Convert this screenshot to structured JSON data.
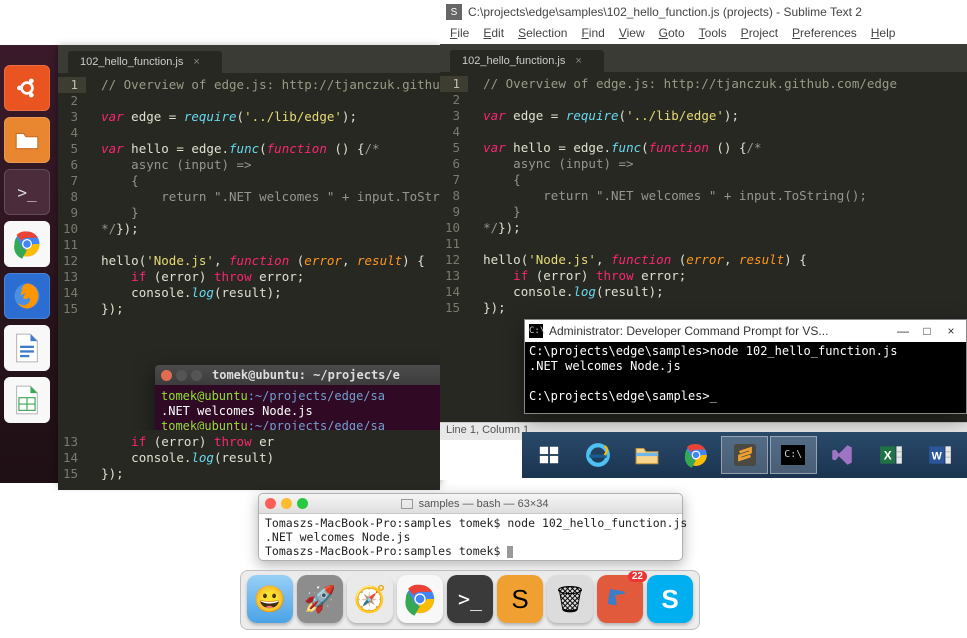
{
  "file_tab_label": "102_hello_function.js",
  "code_lines": [
    {
      "n": "1",
      "seg": [
        {
          "c": "c-comment",
          "t": "// Overview of edge.js: http://tjanczuk.github.com/edge"
        }
      ]
    },
    {
      "n": "2",
      "seg": []
    },
    {
      "n": "3",
      "seg": [
        {
          "c": "c-keyword",
          "t": "var "
        },
        {
          "c": "",
          "t": "edge = "
        },
        {
          "c": "c-func",
          "t": "require"
        },
        {
          "c": "",
          "t": "("
        },
        {
          "c": "c-string",
          "t": "'../lib/edge'"
        },
        {
          "c": "",
          "t": ");"
        }
      ]
    },
    {
      "n": "4",
      "seg": []
    },
    {
      "n": "5",
      "seg": [
        {
          "c": "c-keyword",
          "t": "var "
        },
        {
          "c": "",
          "t": "hello = edge."
        },
        {
          "c": "c-func",
          "t": "func"
        },
        {
          "c": "",
          "t": "("
        },
        {
          "c": "c-keyword",
          "t": "function"
        },
        {
          "c": "",
          "t": " () {"
        },
        {
          "c": "c-gray",
          "t": "/*"
        }
      ]
    },
    {
      "n": "6",
      "seg": [
        {
          "c": "c-gray",
          "t": "    async (input) =>"
        }
      ]
    },
    {
      "n": "7",
      "seg": [
        {
          "c": "c-gray",
          "t": "    {"
        }
      ]
    },
    {
      "n": "8",
      "seg": [
        {
          "c": "c-gray",
          "t": "        return \".NET welcomes \" + input.ToString();"
        }
      ]
    },
    {
      "n": "9",
      "seg": [
        {
          "c": "c-gray",
          "t": "    }"
        }
      ]
    },
    {
      "n": "10",
      "seg": [
        {
          "c": "c-gray",
          "t": "*/"
        },
        {
          "c": "",
          "t": "});"
        }
      ]
    },
    {
      "n": "11",
      "seg": []
    },
    {
      "n": "12",
      "seg": [
        {
          "c": "",
          "t": "hello("
        },
        {
          "c": "c-string",
          "t": "'Node.js'"
        },
        {
          "c": "",
          "t": ", "
        },
        {
          "c": "c-keyword",
          "t": "function"
        },
        {
          "c": "",
          "t": " ("
        },
        {
          "c": "c-param",
          "t": "error"
        },
        {
          "c": "",
          "t": ", "
        },
        {
          "c": "c-param",
          "t": "result"
        },
        {
          "c": "",
          "t": ") {"
        }
      ]
    },
    {
      "n": "13",
      "seg": [
        {
          "c": "",
          "t": "    "
        },
        {
          "c": "c-keyword-n",
          "t": "if"
        },
        {
          "c": "",
          "t": " (error) "
        },
        {
          "c": "c-keyword-n",
          "t": "throw"
        },
        {
          "c": "",
          "t": " error;"
        }
      ]
    },
    {
      "n": "14",
      "seg": [
        {
          "c": "",
          "t": "    console."
        },
        {
          "c": "c-func",
          "t": "log"
        },
        {
          "c": "",
          "t": "(result);"
        }
      ]
    },
    {
      "n": "15",
      "seg": [
        {
          "c": "",
          "t": "});"
        }
      ]
    }
  ],
  "ubuntu": {
    "terminal_title": "tomek@ubuntu: ~/projects/e",
    "term_lines": [
      {
        "pre": "tomek@ubuntu",
        "path": ":~/projects/edge/sa",
        "rest": ""
      },
      {
        "plain": ".NET welcomes Node.js"
      },
      {
        "pre": "tomek@ubuntu",
        "path": ":~/projects/edge/sa",
        "rest": ""
      }
    ],
    "launcher": [
      "ubuntu-icon",
      "files-icon",
      "terminal-icon",
      "chrome-icon",
      "firefox-icon",
      "libreoffice-writer-icon",
      "libreoffice-calc-icon"
    ]
  },
  "windows": {
    "title": "C:\\projects\\edge\\samples\\102_hello_function.js (projects) - Sublime Text 2",
    "menus": [
      "File",
      "Edit",
      "Selection",
      "Find",
      "View",
      "Goto",
      "Tools",
      "Project",
      "Preferences",
      "Help"
    ],
    "status": "Line 1, Column 1",
    "cmd_title": "Administrator: Developer Command Prompt for VS...",
    "cmd_lines": [
      "C:\\projects\\edge\\samples>node 102_hello_function.js",
      ".NET welcomes Node.js",
      "",
      "C:\\projects\\edge\\samples>_"
    ],
    "taskbar": [
      "start-icon",
      "ie-icon",
      "explorer-icon",
      "chrome-icon",
      "sublime-icon",
      "cmd-icon",
      "visualstudio-icon",
      "excel-icon",
      "word-icon"
    ]
  },
  "mac": {
    "extra_code_lines": [
      {
        "n": "13",
        "seg": [
          {
            "c": "",
            "t": "    "
          },
          {
            "c": "c-keyword-n",
            "t": "if"
          },
          {
            "c": "",
            "t": " (error) "
          },
          {
            "c": "c-keyword-n",
            "t": "throw"
          },
          {
            "c": "",
            "t": " er"
          }
        ]
      },
      {
        "n": "14",
        "seg": [
          {
            "c": "",
            "t": "    console."
          },
          {
            "c": "c-func",
            "t": "log"
          },
          {
            "c": "",
            "t": "(result)"
          }
        ]
      },
      {
        "n": "15",
        "seg": [
          {
            "c": "",
            "t": "});"
          }
        ]
      }
    ],
    "term_title": "samples — bash — 63×34",
    "term_lines": [
      "Tomaszs-MacBook-Pro:samples tomek$ node 102_hello_function.js",
      ".NET welcomes Node.js",
      "Tomaszs-MacBook-Pro:samples tomek$ "
    ],
    "dock": [
      {
        "name": "finder-icon",
        "label": "😀"
      },
      {
        "name": "launchpad-icon",
        "label": "🚀"
      },
      {
        "name": "safari-icon",
        "label": "🧭"
      },
      {
        "name": "chrome-icon",
        "label": ""
      },
      {
        "name": "terminal-icon",
        "label": ">_"
      },
      {
        "name": "sublime-icon",
        "label": "S"
      },
      {
        "name": "trash-icon",
        "label": "🗑"
      },
      {
        "name": "virtualbox-icon",
        "label": "",
        "badge": "22"
      },
      {
        "name": "skype-icon",
        "label": "S"
      }
    ]
  }
}
